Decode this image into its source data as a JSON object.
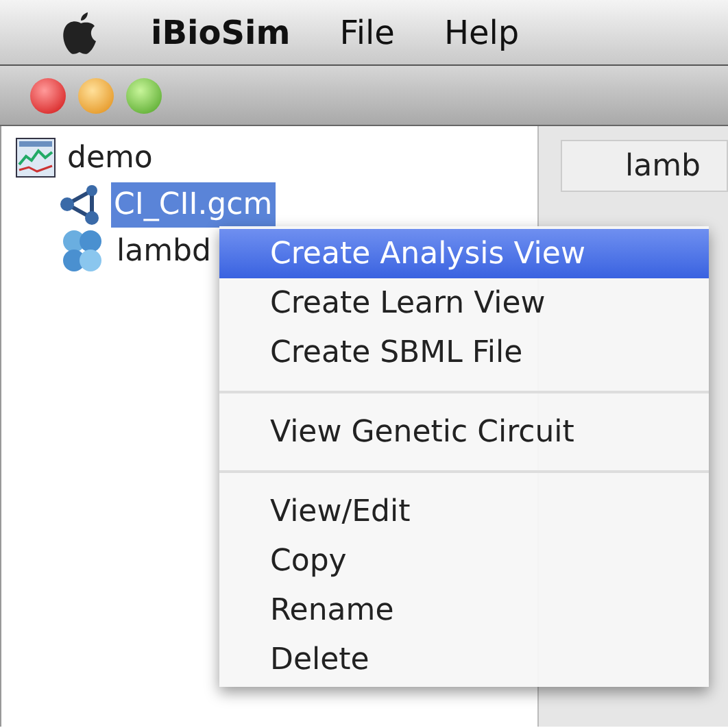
{
  "menu_bar": {
    "app_name": "iBioSim",
    "menus": [
      "File",
      "Help"
    ]
  },
  "tree": [
    {
      "label": "demo",
      "kind": "project",
      "selected": false,
      "children": [
        {
          "label": "CI_CII.gcm",
          "kind": "circuit",
          "selected": true
        },
        {
          "label": "lambd",
          "kind": "sbml",
          "selected": false
        }
      ]
    }
  ],
  "tab": {
    "label": "lamb"
  },
  "context_menu": [
    {
      "label": "Create Analysis View",
      "kind": "item",
      "selected": true
    },
    {
      "label": "Create Learn View",
      "kind": "item",
      "selected": false
    },
    {
      "label": "Create SBML File",
      "kind": "item",
      "selected": false
    },
    {
      "kind": "separator"
    },
    {
      "label": "View Genetic Circuit",
      "kind": "item",
      "selected": false
    },
    {
      "kind": "separator"
    },
    {
      "label": "View/Edit",
      "kind": "item",
      "selected": false
    },
    {
      "label": "Copy",
      "kind": "item",
      "selected": false
    },
    {
      "label": "Rename",
      "kind": "item",
      "selected": false
    },
    {
      "label": "Delete",
      "kind": "item",
      "selected": false
    }
  ]
}
